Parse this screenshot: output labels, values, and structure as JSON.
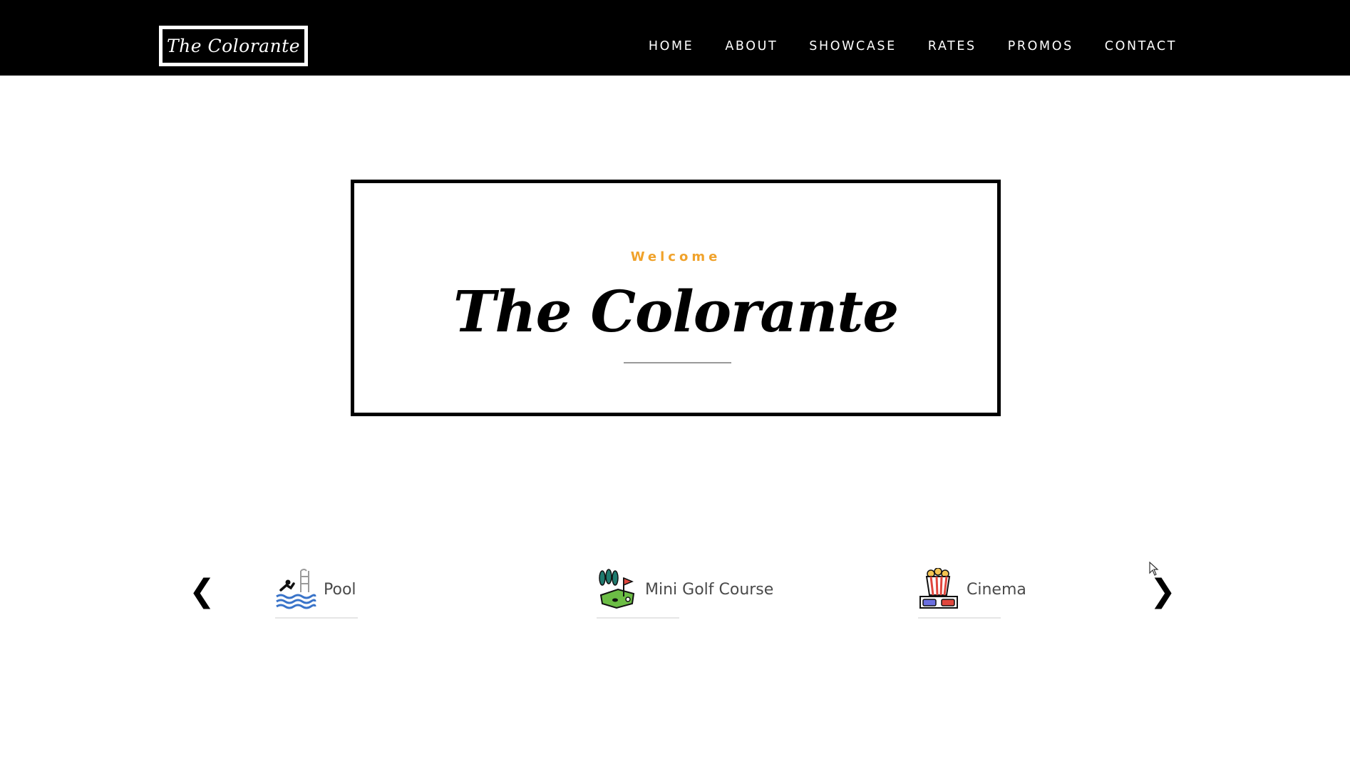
{
  "navbar": {
    "logo_text": "The Colorante",
    "links": [
      {
        "label": "HOME"
      },
      {
        "label": "ABOUT"
      },
      {
        "label": "SHOWCASE"
      },
      {
        "label": "RATES"
      },
      {
        "label": "PROMOS"
      },
      {
        "label": "CONTACT"
      }
    ]
  },
  "hero": {
    "eyebrow": "Welcome",
    "title": "The Colorante"
  },
  "carousel": {
    "prev_glyph": "❮",
    "next_glyph": "❯",
    "items": [
      {
        "label": "Pool",
        "icon": "pool-icon"
      },
      {
        "label": "Mini Golf Course",
        "icon": "mini-golf-icon"
      },
      {
        "label": "Cinema",
        "icon": "cinema-icon"
      }
    ]
  },
  "colors": {
    "navbar_background": "#000000",
    "accent": "#f0a22b",
    "text_on_dark": "#ffffff"
  }
}
